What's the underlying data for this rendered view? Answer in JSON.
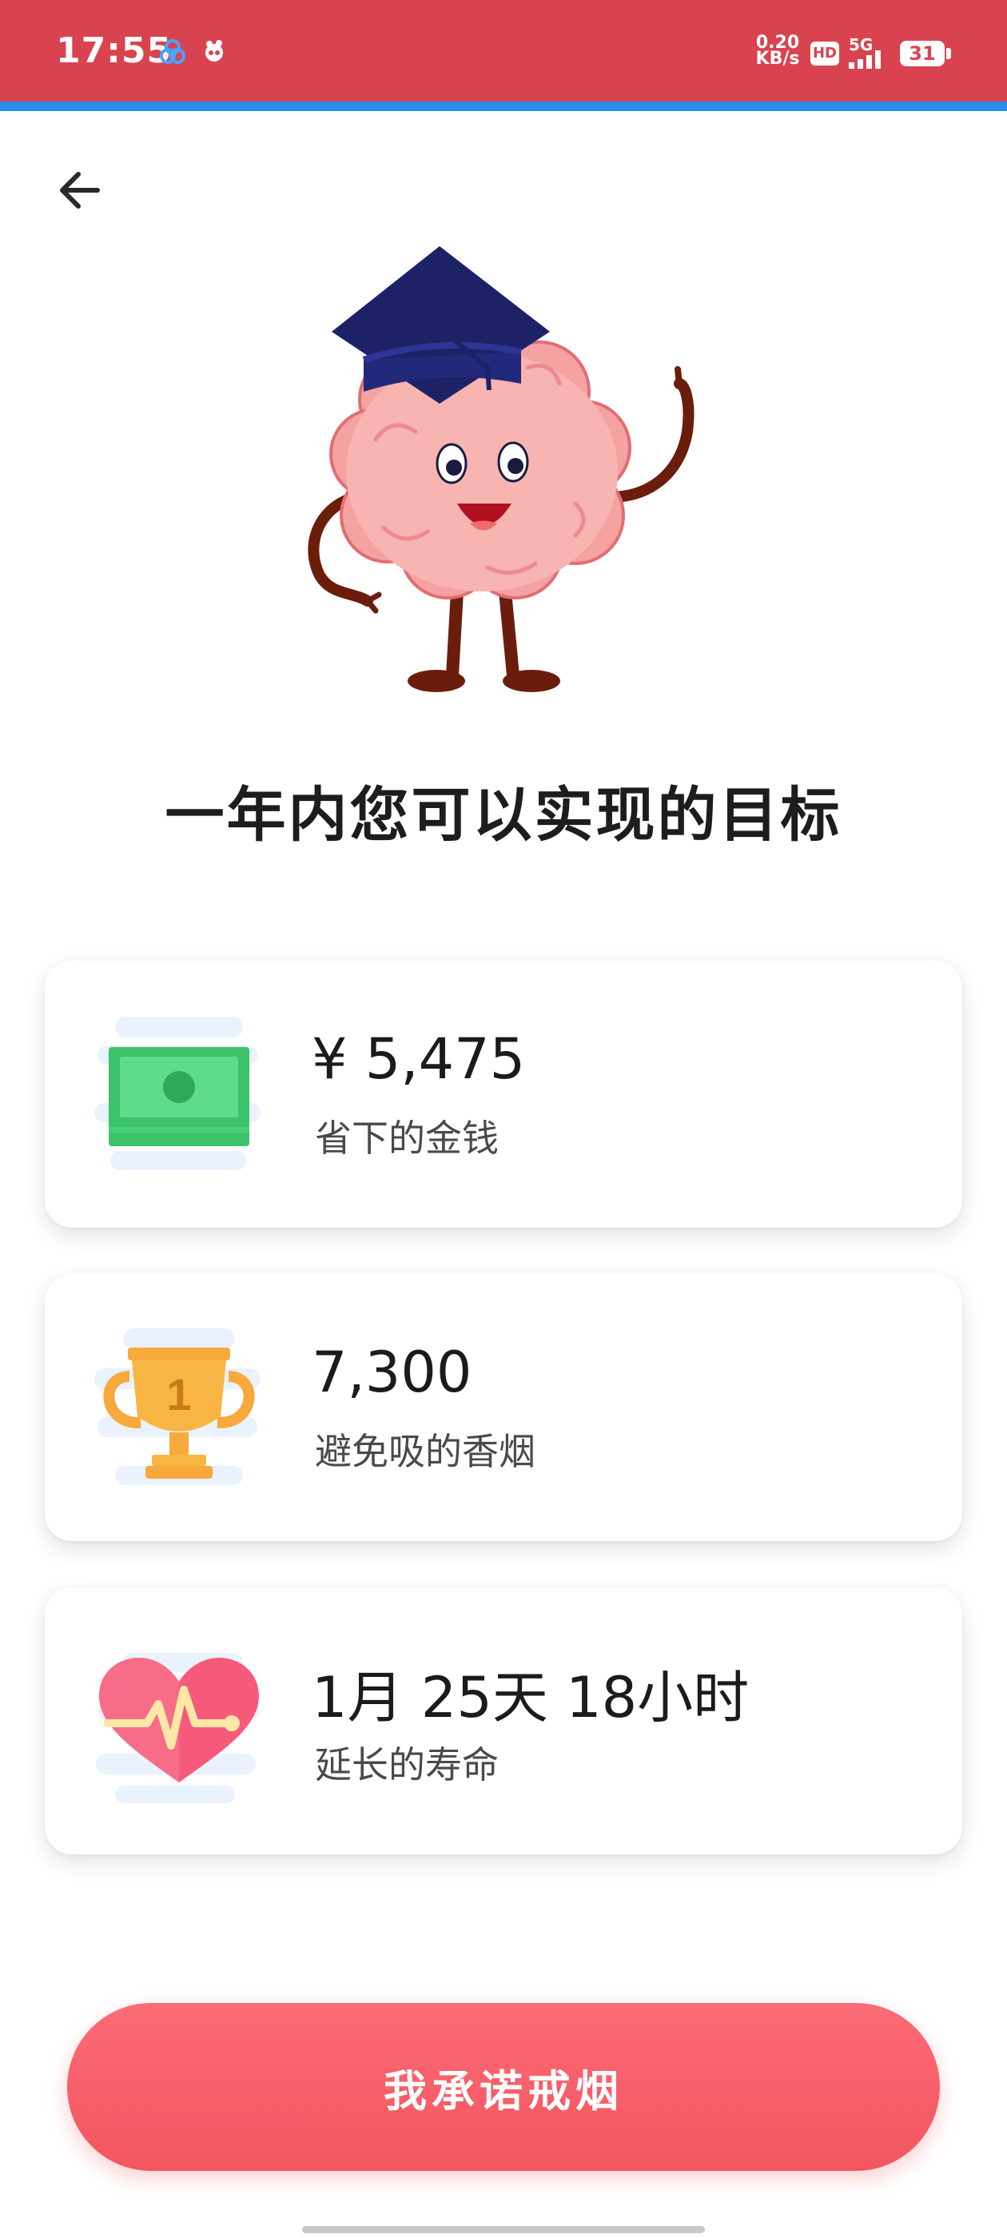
{
  "status_bar": {
    "time": "17:55",
    "net_speed_value": "0.20",
    "net_speed_unit": "KB/s",
    "hd_label": "HD",
    "signal_label": "5G",
    "battery": "31"
  },
  "header": {
    "title": "一年内您可以实现的目标"
  },
  "cards": [
    {
      "value": "¥ 5,475",
      "label": "省下的金钱"
    },
    {
      "value": "7,300",
      "label": "避免吸的香烟"
    },
    {
      "value": "1月 25天 18小时",
      "label": "延长的寿命"
    }
  ],
  "cta": {
    "label": "我承诺戒烟"
  },
  "colors": {
    "status_bar": "#d9434f",
    "accent_strip": "#2b8ce6",
    "primary_button": "#f2555f"
  }
}
